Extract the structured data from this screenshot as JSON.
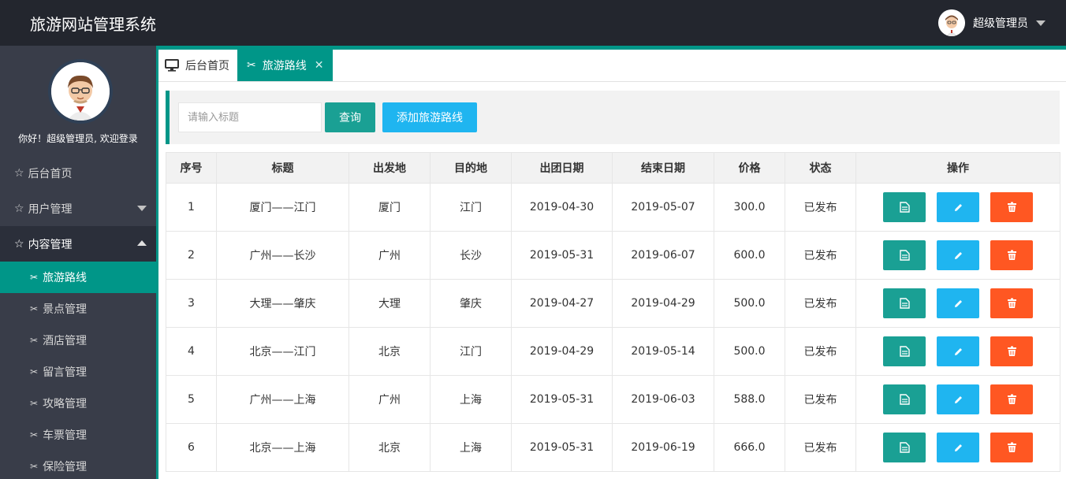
{
  "header": {
    "brand": "旅游网站管理系统",
    "user_name": "超级管理员"
  },
  "sidebar": {
    "welcome": "你好！超级管理员, 欢迎登录",
    "items": [
      {
        "label": "后台首页",
        "icon": "star-icon"
      },
      {
        "label": "用户管理",
        "icon": "star-icon",
        "arrow": "down"
      },
      {
        "label": "内容管理",
        "icon": "star-icon",
        "arrow": "up"
      }
    ],
    "sub_items": [
      {
        "label": "旅游路线",
        "active": true
      },
      {
        "label": "景点管理"
      },
      {
        "label": "酒店管理"
      },
      {
        "label": "留言管理"
      },
      {
        "label": "攻略管理"
      },
      {
        "label": "车票管理"
      },
      {
        "label": "保险管理"
      }
    ]
  },
  "tabs": {
    "home": "后台首页",
    "current": "旅游路线",
    "close": "✕"
  },
  "search": {
    "placeholder": "请输入标题",
    "query_label": "查询",
    "add_label": "添加旅游路线"
  },
  "table": {
    "columns": [
      "序号",
      "标题",
      "出发地",
      "目的地",
      "出团日期",
      "结束日期",
      "价格",
      "状态",
      "操作"
    ],
    "rows": [
      [
        "1",
        "厦门——江门",
        "厦门",
        "江门",
        "2019-04-30",
        "2019-05-07",
        "300.0",
        "已发布"
      ],
      [
        "2",
        "广州——长沙",
        "广州",
        "长沙",
        "2019-05-31",
        "2019-06-07",
        "600.0",
        "已发布"
      ],
      [
        "3",
        "大理——肇庆",
        "大理",
        "肇庆",
        "2019-04-27",
        "2019-04-29",
        "500.0",
        "已发布"
      ],
      [
        "4",
        "北京——江门",
        "北京",
        "江门",
        "2019-04-29",
        "2019-05-14",
        "500.0",
        "已发布"
      ],
      [
        "5",
        "广州——上海",
        "广州",
        "上海",
        "2019-05-31",
        "2019-06-03",
        "588.0",
        "已发布"
      ],
      [
        "6",
        "北京——上海",
        "北京",
        "上海",
        "2019-05-31",
        "2019-06-19",
        "666.0",
        "已发布"
      ]
    ]
  },
  "colors": {
    "accent": "#009688",
    "view_button": "#1aa094",
    "edit_button": "#1fb5f0",
    "delete_button": "#ff5722",
    "header_bg": "#23262e",
    "sidebar_bg": "#393d49"
  }
}
